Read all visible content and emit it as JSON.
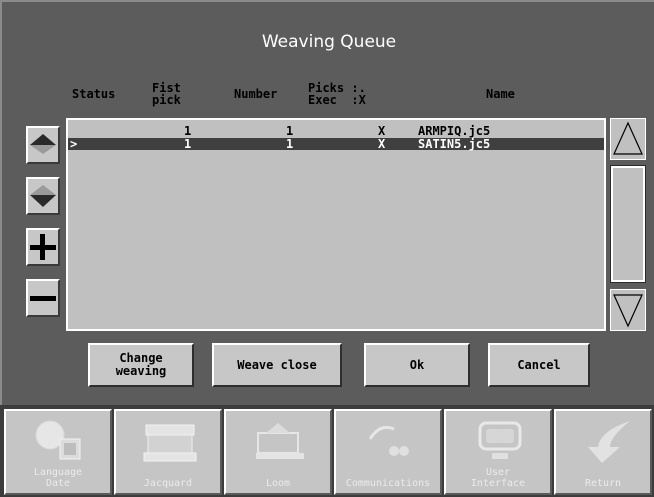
{
  "window": {
    "title": "Weaving Queue"
  },
  "columns": {
    "status": "Status",
    "first_pick": "Fist\npick",
    "number": "Number",
    "picks_exec": "Picks :.\nExec  :X",
    "name": "Name"
  },
  "queue": [
    {
      "status": "",
      "first_pick": "1",
      "number": "1",
      "exec": "X",
      "name": "ARMPIQ.jc5",
      "selected": false
    },
    {
      "status": ">",
      "first_pick": "1",
      "number": "1",
      "exec": "X",
      "name": "SATIN5.jc5",
      "selected": true
    }
  ],
  "side_buttons": [
    {
      "icon": "move-up-icon"
    },
    {
      "icon": "move-down-icon"
    },
    {
      "icon": "plus-icon"
    },
    {
      "icon": "minus-icon"
    }
  ],
  "actions": {
    "change_weaving": "Change\nweaving",
    "weave_close": "Weave close",
    "ok": "Ok",
    "cancel": "Cancel"
  },
  "toolbar": [
    {
      "label": "Language\nDate",
      "icon": "language-date-icon"
    },
    {
      "label": "Jacquard",
      "icon": "jacquard-icon"
    },
    {
      "label": "Loom",
      "icon": "loom-icon"
    },
    {
      "label": "Communications",
      "icon": "communications-icon"
    },
    {
      "label": "User\nInterface",
      "icon": "user-interface-icon"
    },
    {
      "label": "Return",
      "icon": "return-icon"
    }
  ],
  "colors": {
    "background": "#5c5c5c",
    "panel": "#c0c0c0",
    "selection": "#3f3f3f"
  }
}
